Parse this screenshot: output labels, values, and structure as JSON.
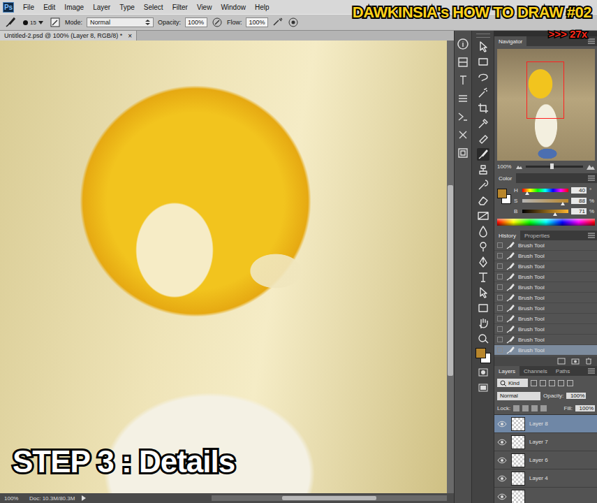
{
  "app": {
    "logo": "Ps"
  },
  "menu": [
    "File",
    "Edit",
    "Image",
    "Layer",
    "Type",
    "Select",
    "Filter",
    "View",
    "Window",
    "Help"
  ],
  "options": {
    "brush_size": "15",
    "mode_label": "Mode:",
    "mode": "Normal",
    "opacity_label": "Opacity:",
    "opacity": "100%",
    "flow_label": "Flow:",
    "flow": "100%"
  },
  "document": {
    "tab": "Untitled-2.psd @ 100% (Layer 8, RGB/8) *",
    "close": "×"
  },
  "canvas": {
    "scroll_position": 0.32,
    "scroll_size": 0.42
  },
  "overlay": {
    "title": "DAWKINSIA's HOW TO DRAW #02",
    "speed": ">>> 27x",
    "step": "STEP 3 : Details"
  },
  "status_bar": {
    "zoom": "100%",
    "doc": "Doc: 10.3M/80.3M"
  },
  "navigator": {
    "title": "Navigator",
    "zoom": "100%",
    "level": 0.45
  },
  "color": {
    "title": "Color",
    "foreground": "#b8862c",
    "background": "#ffffff",
    "channels": [
      {
        "name": "H",
        "value": "40",
        "unit": "°",
        "level": 0.11
      },
      {
        "name": "S",
        "value": "88",
        "unit": "%",
        "level": 0.88
      },
      {
        "name": "B",
        "value": "71",
        "unit": "%",
        "level": 0.71
      }
    ]
  },
  "history": {
    "tabs": [
      {
        "label": "History",
        "selected": true
      },
      {
        "label": "Properties",
        "selected": false
      }
    ],
    "items": [
      {
        "label": "Brush Tool",
        "selected": false
      },
      {
        "label": "Brush Tool",
        "selected": false
      },
      {
        "label": "Brush Tool",
        "selected": false
      },
      {
        "label": "Brush Tool",
        "selected": false
      },
      {
        "label": "Brush Tool",
        "selected": false
      },
      {
        "label": "Brush Tool",
        "selected": false
      },
      {
        "label": "Brush Tool",
        "selected": false
      },
      {
        "label": "Brush Tool",
        "selected": false
      },
      {
        "label": "Brush Tool",
        "selected": false
      },
      {
        "label": "Brush Tool",
        "selected": false
      },
      {
        "label": "Brush Tool",
        "selected": true
      }
    ]
  },
  "layers": {
    "tabs": [
      {
        "label": "Layers",
        "selected": true
      },
      {
        "label": "Channels",
        "selected": false
      },
      {
        "label": "Paths",
        "selected": false
      }
    ],
    "filter": "Kind",
    "blend": "Normal",
    "opacity_label": "Opacity:",
    "opacity": "100%",
    "lock_label": "Lock:",
    "fill_label": "Fill:",
    "fill": "100%",
    "items": [
      {
        "name": "Layer 8",
        "selected": true,
        "visible": true
      },
      {
        "name": "Layer 7",
        "selected": false,
        "visible": true
      },
      {
        "name": "Layer 6",
        "selected": false,
        "visible": true
      },
      {
        "name": "Layer 4",
        "selected": false,
        "visible": true
      }
    ]
  }
}
